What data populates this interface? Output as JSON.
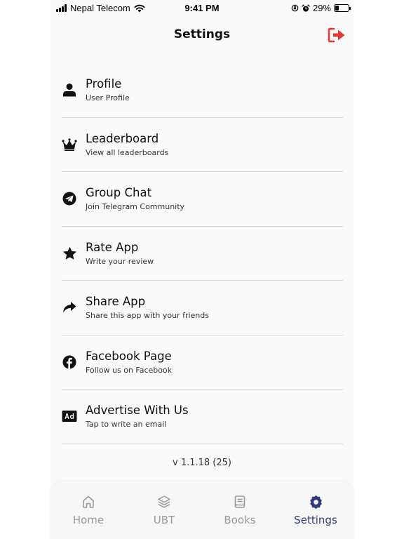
{
  "status_bar": {
    "carrier": "Nepal Telecom",
    "time": "9:41 PM",
    "battery": "29%",
    "battery_level": 0.29
  },
  "header": {
    "title": "Settings",
    "logout_icon": "logout-icon",
    "accent_color": "#e53935"
  },
  "menu": [
    {
      "title": "Profile",
      "subtitle": "User Profile",
      "icon": "person-icon"
    },
    {
      "title": "Leaderboard",
      "subtitle": "View all leaderboards",
      "icon": "crown-icon"
    },
    {
      "title": "Group Chat",
      "subtitle": "Join Telegram Community",
      "icon": "telegram-icon"
    },
    {
      "title": "Rate App",
      "subtitle": "Write your review",
      "icon": "star-icon"
    },
    {
      "title": "Share App",
      "subtitle": "Share this app with your friends",
      "icon": "share-icon"
    },
    {
      "title": "Facebook Page",
      "subtitle": "Follow us on Facebook",
      "icon": "facebook-icon"
    },
    {
      "title": "Advertise With Us",
      "subtitle": "Tap to write an email",
      "icon": "ad-icon"
    }
  ],
  "version": "v 1.1.18 (25)",
  "tab_bar": {
    "active_color": "#2e3a7a",
    "inactive_color": "#999999",
    "tabs": [
      {
        "label": "Home",
        "icon": "home-icon",
        "active": false
      },
      {
        "label": "UBT",
        "icon": "layers-icon",
        "active": false
      },
      {
        "label": "Books",
        "icon": "book-icon",
        "active": false
      },
      {
        "label": "Settings",
        "icon": "gear-icon",
        "active": true
      }
    ]
  }
}
